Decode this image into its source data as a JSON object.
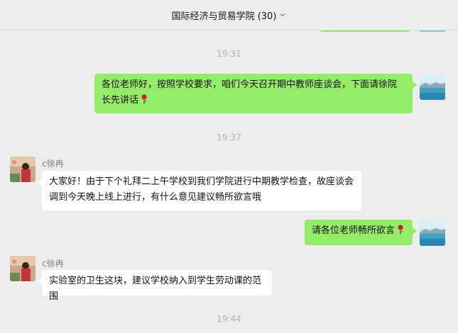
{
  "header": {
    "title": "国际经济与贸易学院 (30)",
    "dropdown_icon": "chevron-down-icon"
  },
  "messages": {
    "time_1": "19:31",
    "msg_1": {
      "sender": "self",
      "text": "各位老师好，按照学校要求，咱们今天召开期中教师座谈会，下面请徐院长先讲话",
      "emoji": "rose-icon"
    },
    "time_2": "19:37",
    "msg_2": {
      "sender_name": "c徐冉",
      "text": "大家好！由于下个礼拜二上午学校到我们学院进行中期教学检查，故座谈会调到今天晚上线上进行，有什么意见建议畅所欲言哦"
    },
    "msg_3": {
      "sender": "self",
      "text": "请各位老师畅所欲言",
      "emoji": "rose-icon"
    },
    "msg_4": {
      "sender_name": "c徐冉",
      "text": "实验室的卫生这块，建议学校纳入到学生劳动课的范围"
    },
    "time_3": "19:44"
  },
  "colors": {
    "outgoing_bubble": "#95ec69",
    "incoming_bubble": "#ffffff",
    "background": "#ededed",
    "timestamp": "#b2b2b2"
  }
}
